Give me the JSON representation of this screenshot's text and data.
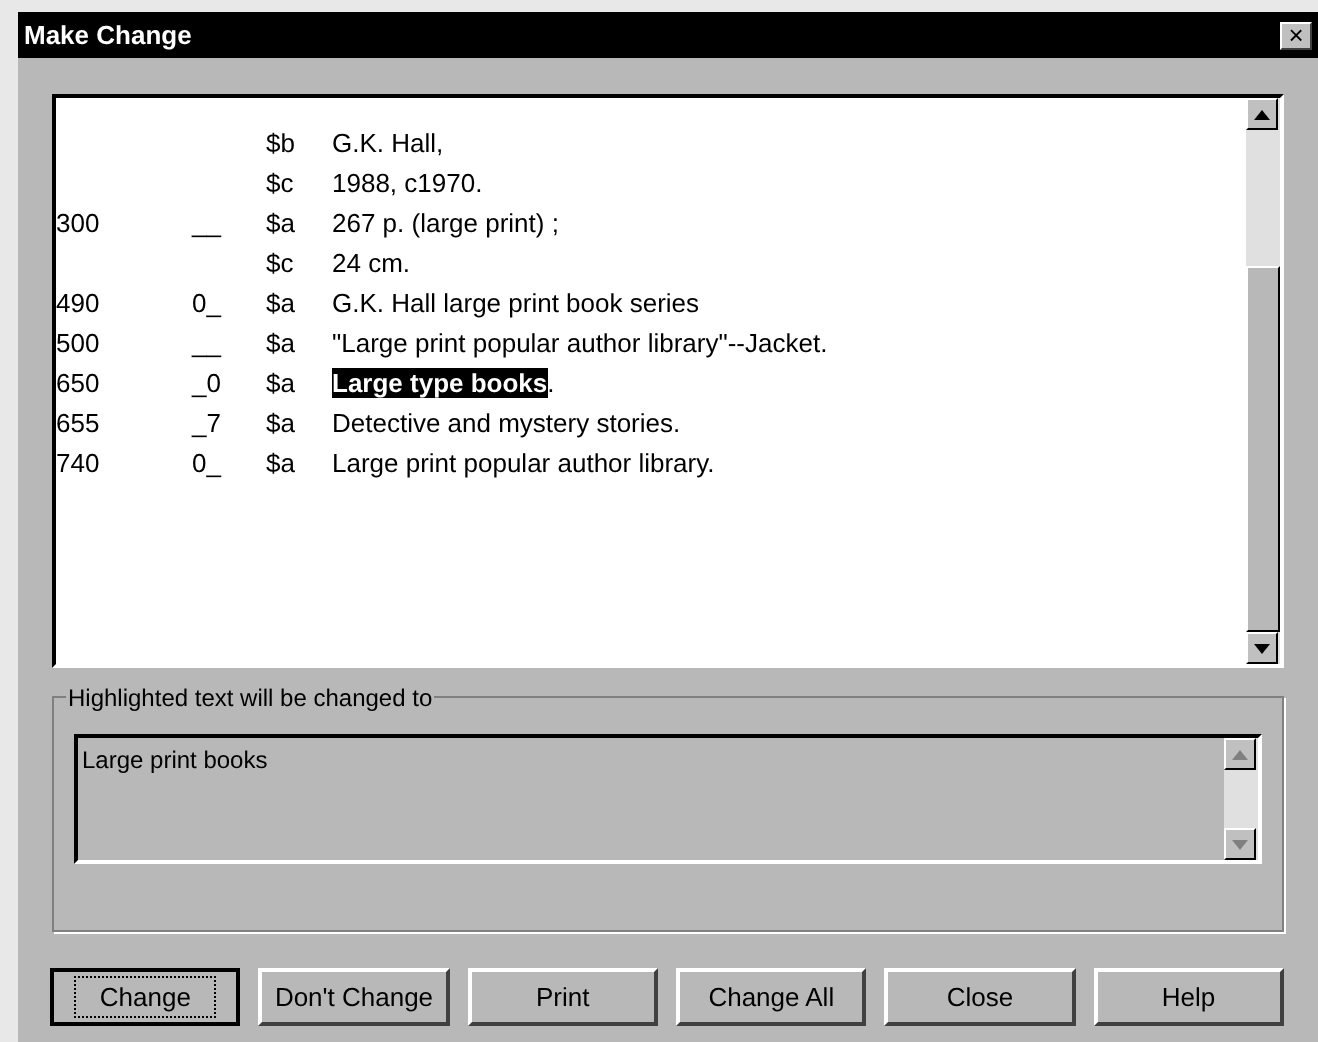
{
  "window": {
    "title": "Make Change",
    "close": "×"
  },
  "record": {
    "rows": [
      {
        "subfield": "$b",
        "segments": [
          {
            "text": "G.K. Hall,",
            "highlighted": false
          }
        ]
      },
      {
        "subfield": "$c",
        "segments": [
          {
            "text": "1988, c1970.",
            "highlighted": false
          }
        ]
      },
      {
        "tag": "300",
        "indicators": "__",
        "subfield": "$a",
        "segments": [
          {
            "text": "267 p. (large print) ;",
            "highlighted": false
          }
        ]
      },
      {
        "subfield": "$c",
        "segments": [
          {
            "text": "24 cm.",
            "highlighted": false
          }
        ]
      },
      {
        "tag": "490",
        "indicators": "0_",
        "subfield": "$a",
        "segments": [
          {
            "text": "G.K. Hall large print book series",
            "highlighted": false
          }
        ]
      },
      {
        "tag": "500",
        "indicators": "__",
        "subfield": "$a",
        "segments": [
          {
            "text": "\"Large print popular author library\"--Jacket.",
            "highlighted": false
          }
        ]
      },
      {
        "tag": "650",
        "indicators": "_0",
        "subfield": "$a",
        "segments": [
          {
            "text": "Large type books",
            "highlighted": true
          },
          {
            "text": ".",
            "highlighted": false
          }
        ]
      },
      {
        "tag": "655",
        "indicators": "_7",
        "subfield": "$a",
        "segments": [
          {
            "text": "Detective and mystery stories.",
            "highlighted": false
          }
        ]
      },
      {
        "tag": "740",
        "indicators": "0_",
        "subfield": "$a",
        "segments": [
          {
            "text": "Large print popular author library.",
            "highlighted": false
          }
        ]
      }
    ]
  },
  "change_to": {
    "legend": "Highlighted text will be changed to",
    "value": "Large print books"
  },
  "buttons": [
    {
      "label": "Change",
      "default": true
    },
    {
      "label": "Don't Change",
      "default": false
    },
    {
      "label": "Print",
      "default": false
    },
    {
      "label": "Change All",
      "default": false
    },
    {
      "label": "Close",
      "default": false
    },
    {
      "label": "Help",
      "default": false
    }
  ]
}
